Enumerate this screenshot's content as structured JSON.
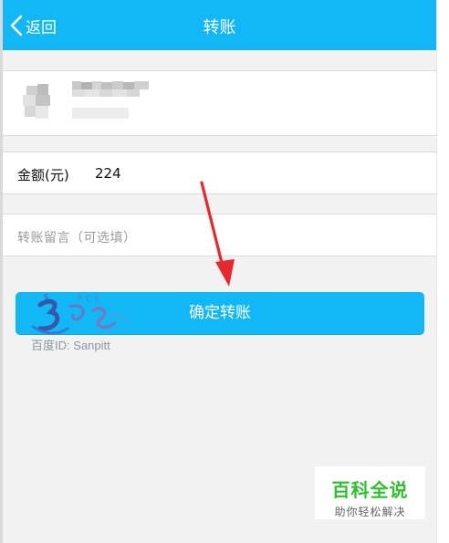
{
  "header": {
    "back_label": "返回",
    "title": "转账"
  },
  "recipient": {
    "avatar_icon": "pixelated-avatar",
    "name": "",
    "subtitle": ""
  },
  "amount": {
    "label": "金额(元)",
    "value": "224"
  },
  "note": {
    "placeholder": "转账留言（可选填）"
  },
  "confirm": {
    "label": "确定转账"
  },
  "watermark": {
    "logo_letters": [
      "S",
      "P",
      "C",
      "S"
    ],
    "text": "百度ID: Sanpitt"
  },
  "badge": {
    "title": "百科全说",
    "subtitle": "助你轻松解决"
  },
  "colors": {
    "accent": "#12b7f5",
    "arrow": "#e8262e",
    "badge_green": "#2fbf2f"
  }
}
